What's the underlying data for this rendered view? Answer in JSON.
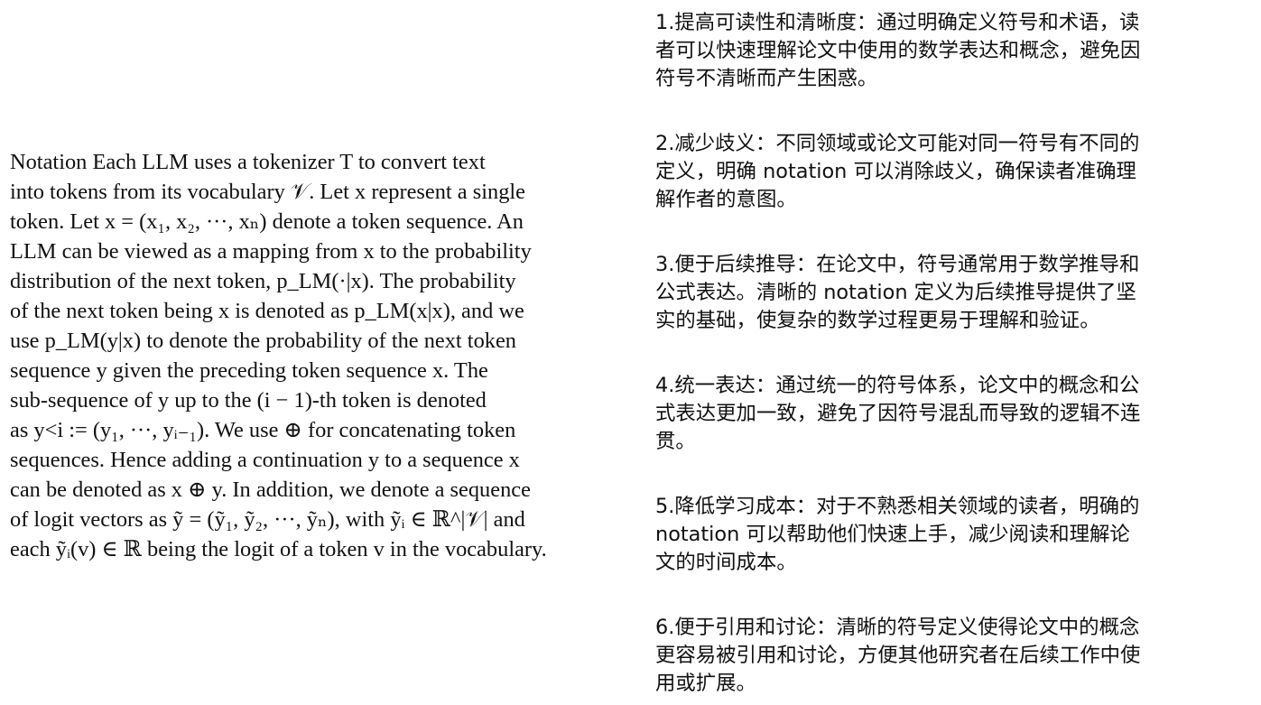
{
  "notation_paragraph": {
    "lines": [
      "Notation    Each LLM uses a tokenizer T to convert text",
      "into tokens from its vocabulary 𝒱. Let x represent a single",
      "token. Let x = (x₁, x₂, ···, xₙ) denote a token sequence. An",
      "LLM can be viewed as a mapping from x to the probability",
      "distribution of the next token, p_LM(·|x).  The probability",
      "of the next token being x is denoted as p_LM(x|x), and we",
      "use p_LM(y|x) to denote the probability of the next token",
      "sequence y given the preceding token sequence x.  The",
      "sub-sequence of y up to the (i − 1)-th token is denoted",
      "as y<i := (y₁, ···, yᵢ₋₁). We use ⊕ for concatenating token",
      "sequences. Hence adding a continuation y to a sequence x",
      "can be denoted as x ⊕ y. In addition, we denote a sequence",
      "of logit vectors as ỹ = (ỹ₁, ỹ₂, ···, ỹₙ), with ỹᵢ ∈ ℝ^|𝒱| and",
      "each ỹᵢ(v) ∈ ℝ being the logit of a token v in the vocabulary."
    ]
  },
  "benefits": [
    {
      "lines": [
        "1.提高可读性和清晰度：通过明确定义符号和术语，读",
        "者可以快速理解论文中使用的数学表达和概念，避免因",
        "符号不清晰而产生困惑。"
      ]
    },
    {
      "lines": [
        "2.减少歧义：不同领域或论文可能对同一符号有不同的",
        "定义，明确 notation 可以消除歧义，确保读者准确理",
        "解作者的意图。"
      ]
    },
    {
      "lines": [
        "3.便于后续推导：在论文中，符号通常用于数学推导和",
        "公式表达。清晰的 notation 定义为后续推导提供了坚",
        "实的基础，使复杂的数学过程更易于理解和验证。"
      ]
    },
    {
      "lines": [
        "4.统一表达：通过统一的符号体系，论文中的概念和公",
        "式表达更加一致，避免了因符号混乱而导致的逻辑不连",
        "贯。"
      ]
    },
    {
      "lines": [
        "5.降低学习成本：对于不熟悉相关领域的读者，明确的",
        "notation 可以帮助他们快速上手，减少阅读和理解论",
        "文的时间成本。"
      ]
    },
    {
      "lines": [
        "6.便于引用和讨论：清晰的符号定义使得论文中的概念",
        "更容易被引用和讨论，方便其他研究者在后续工作中使",
        "用或扩展。"
      ]
    }
  ]
}
